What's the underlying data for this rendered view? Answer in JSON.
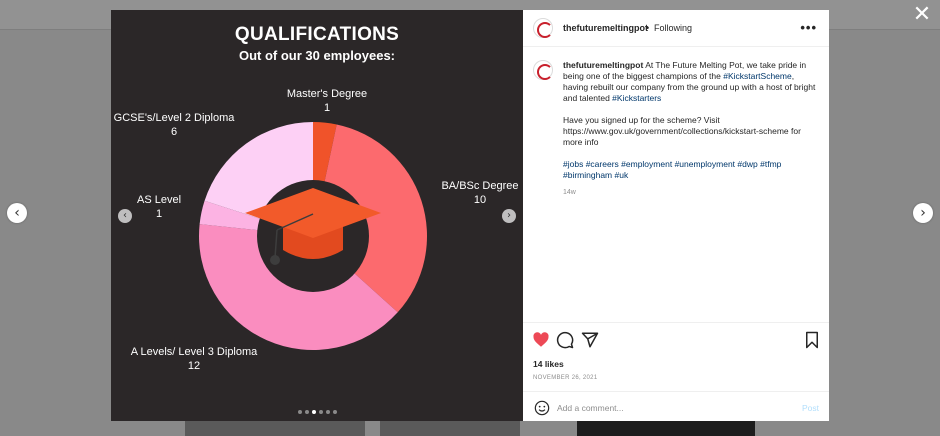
{
  "nav": {
    "close_glyph": "✕",
    "prev_glyph": "‹",
    "next_glyph": "›"
  },
  "media": {
    "title": "QUALIFICATIONS",
    "subtitle": "Out of our 30 employees:",
    "prev_glyph": "‹",
    "next_glyph": "›",
    "carousel_total": 6,
    "carousel_active": 3,
    "center_icon": "graduation-cap-icon"
  },
  "chart_data": {
    "type": "pie",
    "title": "QUALIFICATIONS",
    "subtitle": "Out of our 30 employees:",
    "categories": [
      "Master's Degree",
      "BA/BSc Degree",
      "A Levels/ Level 3 Diploma",
      "AS Level",
      "GCSE's/Level 2 Diploma"
    ],
    "values": [
      1,
      10,
      12,
      1,
      6
    ],
    "colors": [
      "#f0532a",
      "#fc6a6e",
      "#fa8dbf",
      "#fcb3e3",
      "#fdd0f5"
    ]
  },
  "post": {
    "username": "thefuturemeltingpot",
    "separator": "•",
    "follow_status": "Following",
    "more_glyph": "•••",
    "caption_text_1": "At The Future Melting Pot, we take pride in being one of the biggest champions of the",
    "caption_tag_1": "#KickstartScheme",
    "caption_text_2": ", having rebuilt our company from the ground up with a host of bright and talented",
    "caption_tag_2": "#Kickstarters",
    "caption_para_2": "Have you signed up for the scheme? Visit https://www.gov.uk/government/collections/kickstart-scheme for more info",
    "hashtags": [
      "#jobs",
      "#careers",
      "#employment",
      "#unemployment",
      "#dwp",
      "#tfmp",
      "#birmingham",
      "#uk"
    ],
    "age": "14w",
    "likes": "14 likes",
    "date": "NOVEMBER 26, 2021",
    "comment_placeholder": "Add a comment...",
    "post_label": "Post",
    "colors": {
      "heart": "#ed4956",
      "hashtag": "#00376b",
      "post_button": "#b2dffc"
    }
  }
}
